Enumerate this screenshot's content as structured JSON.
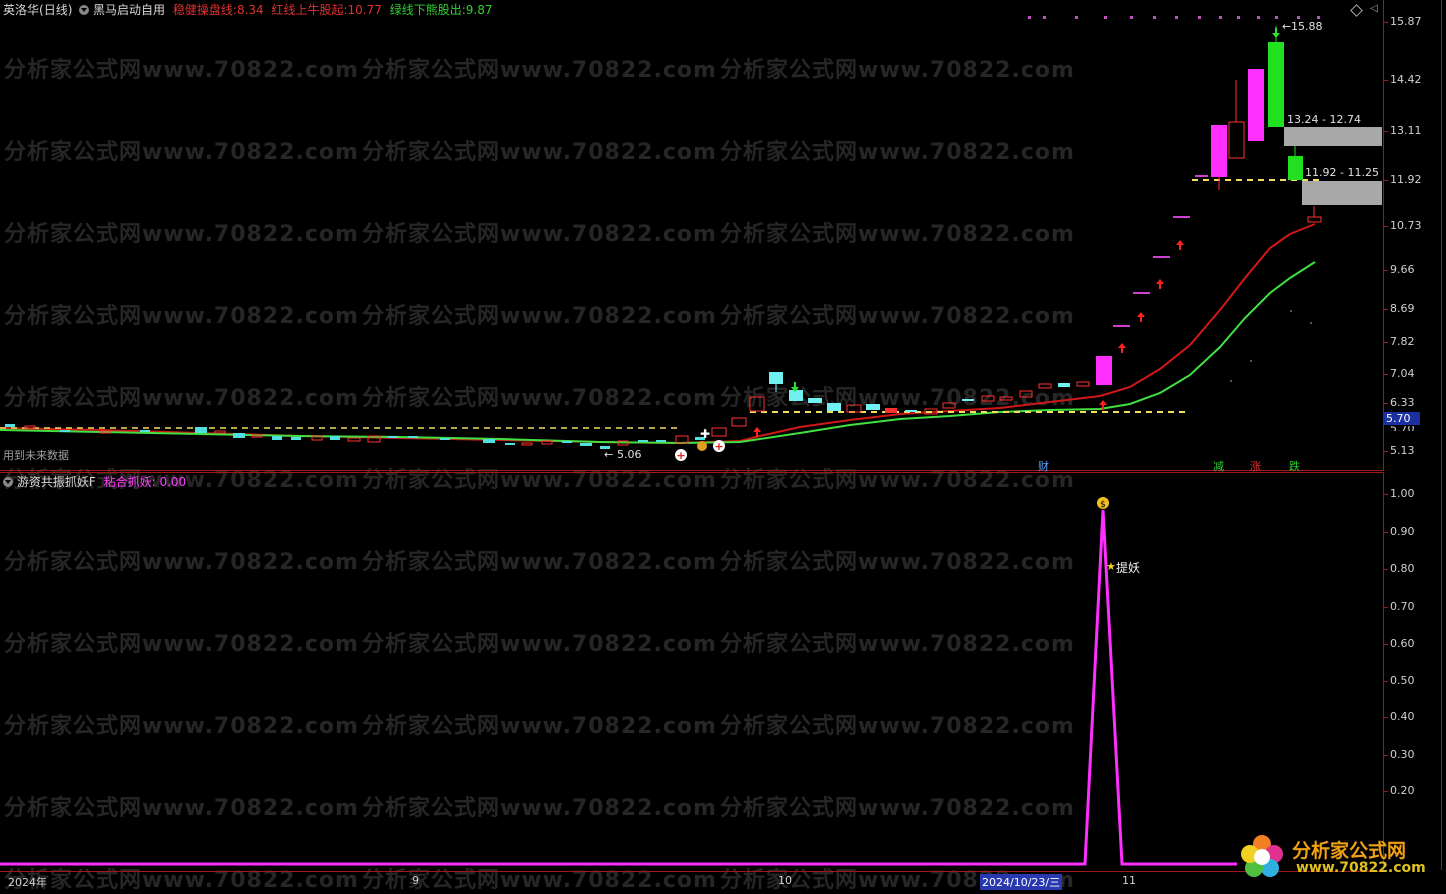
{
  "upper_panel": {
    "stock_name": "英洛华",
    "period": "(日线)",
    "indicator_name": "黑马启动自用",
    "lines": [
      {
        "label": "稳健操盘线:",
        "value": "8.34",
        "color": "#e03030"
      },
      {
        "label": "红线上牛股起:",
        "value": "10.77",
        "color": "#e03030"
      },
      {
        "label": "绿线下熊股出:",
        "value": "9.87",
        "color": "#30d030"
      }
    ],
    "price_axis": [
      "15.87",
      "14.42",
      "13.11",
      "11.92",
      "10.73",
      "9.66",
      "8.69",
      "7.82",
      "7.04",
      "6.33",
      "5.70",
      "5.13"
    ],
    "current_price_badge": "5.70",
    "partial_tick": "5.70",
    "annotations": {
      "high_label": "15.88",
      "low_label": "5.06",
      "gap_zone_1": "13.24 - 12.74",
      "gap_zone_2": "11.92 - 11.25",
      "future_data_note": "用到未来数据"
    },
    "event_markers": [
      {
        "text": "财",
        "color": "#60a0ff"
      },
      {
        "text": "减",
        "color": "#30d030"
      },
      {
        "text": "涨",
        "color": "#e03030"
      },
      {
        "text": "跌",
        "color": "#30d030"
      }
    ]
  },
  "lower_panel": {
    "indicator_name": "游资共振抓妖F",
    "line_label": "粘合抓妖:",
    "line_value": "0.00",
    "line_color": "#ff40ff",
    "axis": [
      "1.00",
      "0.90",
      "0.80",
      "0.70",
      "0.60",
      "0.50",
      "0.40",
      "0.30",
      "0.20"
    ],
    "signal_label": "提妖",
    "signal_star": "★"
  },
  "x_axis": {
    "labels": [
      "2024年",
      "9",
      "10",
      "2024/10/23/三",
      "11"
    ]
  },
  "watermark": "分析家公式网www.70822.com",
  "logo": {
    "text": "分析家公式网",
    "url_text": "www.70822.com"
  },
  "colors": {
    "frame": "#a01818",
    "up": "#ff2020",
    "down": "#50e0e0",
    "magenta": "#ff30ff",
    "green_bar": "#20e020",
    "red_line": "#d01818",
    "green_line": "#40e040",
    "dash": "#f0e060"
  },
  "icons": [
    "diamond-icon",
    "collapse-icon",
    "expand-icon"
  ]
}
